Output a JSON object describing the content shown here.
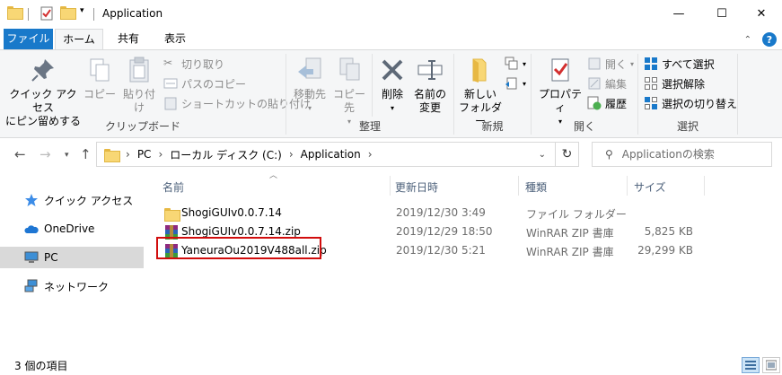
{
  "window": {
    "title": "Application",
    "minimize": "—",
    "maximize": "☐",
    "close": "✕"
  },
  "ribbon_tabs": {
    "file": "ファイル",
    "home": "ホーム",
    "share": "共有",
    "view": "表示"
  },
  "clipboard": {
    "pin_quick_access_line1": "クイック アクセス",
    "pin_quick_access_line2": "にピン留めする",
    "copy": "コピー",
    "paste": "貼り付け",
    "cut": "切り取り",
    "copy_path": "パスのコピー",
    "paste_shortcut": "ショートカットの貼り付け",
    "label": "クリップボード"
  },
  "organize": {
    "move_to": "移動先",
    "copy_to": "コピー先",
    "delete": "削除",
    "rename_line1": "名前の",
    "rename_line2": "変更",
    "label": "整理"
  },
  "new_group": {
    "new_folder_line1": "新しい",
    "new_folder_line2": "フォルダー",
    "label": "新規"
  },
  "open_group": {
    "properties": "プロパティ",
    "open": "開く",
    "edit": "編集",
    "history": "履歴",
    "label": "開く"
  },
  "select_group": {
    "select_all": "すべて選択",
    "select_none": "選択解除",
    "invert": "選択の切り替え",
    "label": "選択"
  },
  "address": {
    "crumbs": [
      "PC",
      "ローカル ディスク (C:)",
      "Application"
    ],
    "search_placeholder": "Applicationの検索"
  },
  "nav_pane": {
    "items": [
      "クイック アクセス",
      "OneDrive",
      "PC",
      "ネットワーク"
    ],
    "selected": "PC"
  },
  "file_list": {
    "columns": [
      "名前",
      "更新日時",
      "種類",
      "サイズ"
    ],
    "rows": [
      {
        "name": "ShogiGUIv0.0.7.14",
        "modified": "2019/12/30 3:49",
        "type": "ファイル フォルダー",
        "size": "",
        "icon": "folder-icon"
      },
      {
        "name": "ShogiGUIv0.0.7.14.zip",
        "modified": "2019/12/29 18:50",
        "type": "WinRAR ZIP 書庫",
        "size": "5,825 KB",
        "icon": "winrar-zip-icon"
      },
      {
        "name": "YaneuraOu2019V488all.zip",
        "modified": "2019/12/30 5:21",
        "type": "WinRAR ZIP 書庫",
        "size": "29,299 KB",
        "icon": "winrar-zip-icon"
      }
    ],
    "highlighted_row": 2,
    "highlight_color": "#d10d0d"
  },
  "status": {
    "item_count": "3 個の項目"
  },
  "colors": {
    "accent": "#1979ca",
    "ribbon_bg": "#f5f6f7"
  }
}
